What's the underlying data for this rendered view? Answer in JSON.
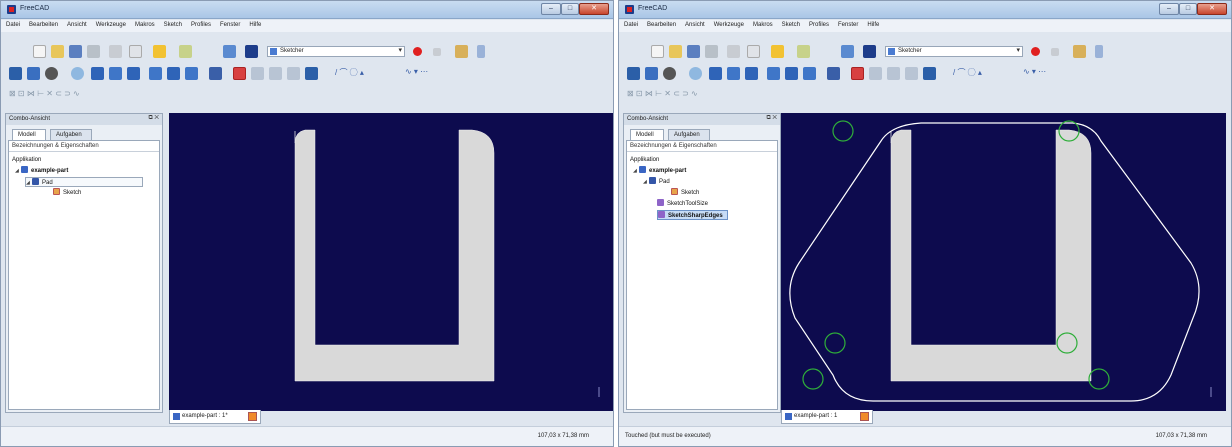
{
  "app_title": "FreeCAD",
  "menus": [
    "Datei",
    "Bearbeiten",
    "Ansicht",
    "Werkzeuge",
    "Makros",
    "Sketch",
    "Profiles",
    "Fenster",
    "Hilfe"
  ],
  "workbench": "Sketcher",
  "combo": {
    "title": "Combo-Ansicht",
    "tabs": [
      "Modell",
      "Aufgaben"
    ],
    "header": "Bezeichnungen & Eigenschaften",
    "root": "Applikation"
  },
  "left": {
    "tree": {
      "part": "example-part",
      "pad": "Pad",
      "sketch": "Sketch"
    },
    "doc_tab": "example-part : 1*",
    "status": "",
    "dims": "107,03 x 71,38 mm"
  },
  "right": {
    "tree": {
      "part": "example-part",
      "pad": "Pad",
      "sketch": "Sketch",
      "shape1": "SketchToolSize",
      "shape2": "SketchSharpEdges"
    },
    "doc_tab": "example-part : 1",
    "status": "Touched (but must be executed)",
    "dims": "107,03 x 71,38 mm"
  },
  "colors": {
    "viewport": "#0d0b4e",
    "part_fill": "#d9d9d9",
    "toolpath": "#ffffff",
    "corner_marker": "#2fae3a",
    "record": "#e02020"
  },
  "icons": [
    "new-icon",
    "open-icon",
    "save-icon",
    "print-icon",
    "cut-icon",
    "paste-icon",
    "undo-icon",
    "redo-icon",
    "refresh-icon",
    "whatsthis-icon",
    "record-icon",
    "stop-icon",
    "macro-icon",
    "play-icon",
    "fit-all-icon",
    "zoom-icon",
    "draw-style-icon",
    "axo-icon",
    "front-icon",
    "top-icon",
    "right-icon",
    "rear-icon",
    "bottom-icon",
    "left-icon",
    "measure-icon",
    "sketch-icon",
    "part-icon"
  ]
}
